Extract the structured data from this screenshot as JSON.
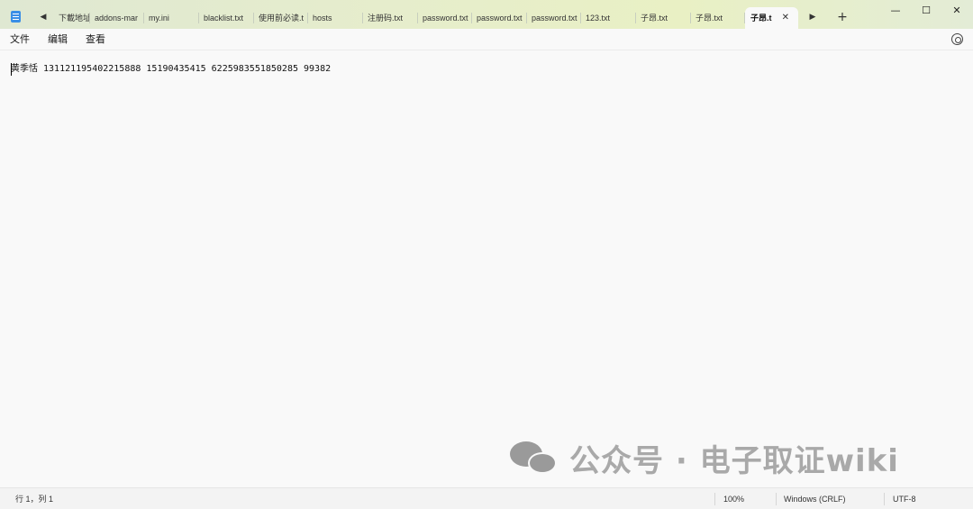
{
  "tabs": [
    {
      "label": "下載地址"
    },
    {
      "label": "addons-mar"
    },
    {
      "label": "my.ini"
    },
    {
      "label": "blacklist.txt"
    },
    {
      "label": "使用前必读.t"
    },
    {
      "label": "hosts"
    },
    {
      "label": "注册码.txt"
    },
    {
      "label": "password.txt"
    },
    {
      "label": "password.txt"
    },
    {
      "label": "password.txt"
    },
    {
      "label": "123.txt"
    },
    {
      "label": "子昂.txt"
    },
    {
      "label": "子昂.txt"
    },
    {
      "label": "子昂.t",
      "active": true
    }
  ],
  "menu": {
    "file": "文件",
    "edit": "编辑",
    "view": "查看"
  },
  "editor": {
    "line1": "黄季恬 131121195402215888 15190435415 6225983551850285 99382"
  },
  "statusbar": {
    "position": "行 1，列 1",
    "zoom": "100%",
    "line_ending": "Windows (CRLF)",
    "encoding": "UTF-8"
  },
  "watermark": {
    "text": "公众号 · 电子取证wiki"
  },
  "icons": {
    "app": "notepad-icon",
    "settings": "gear-icon"
  },
  "colors": {
    "accent": "#3a8ee6",
    "titlebar": "#e6edcc"
  }
}
